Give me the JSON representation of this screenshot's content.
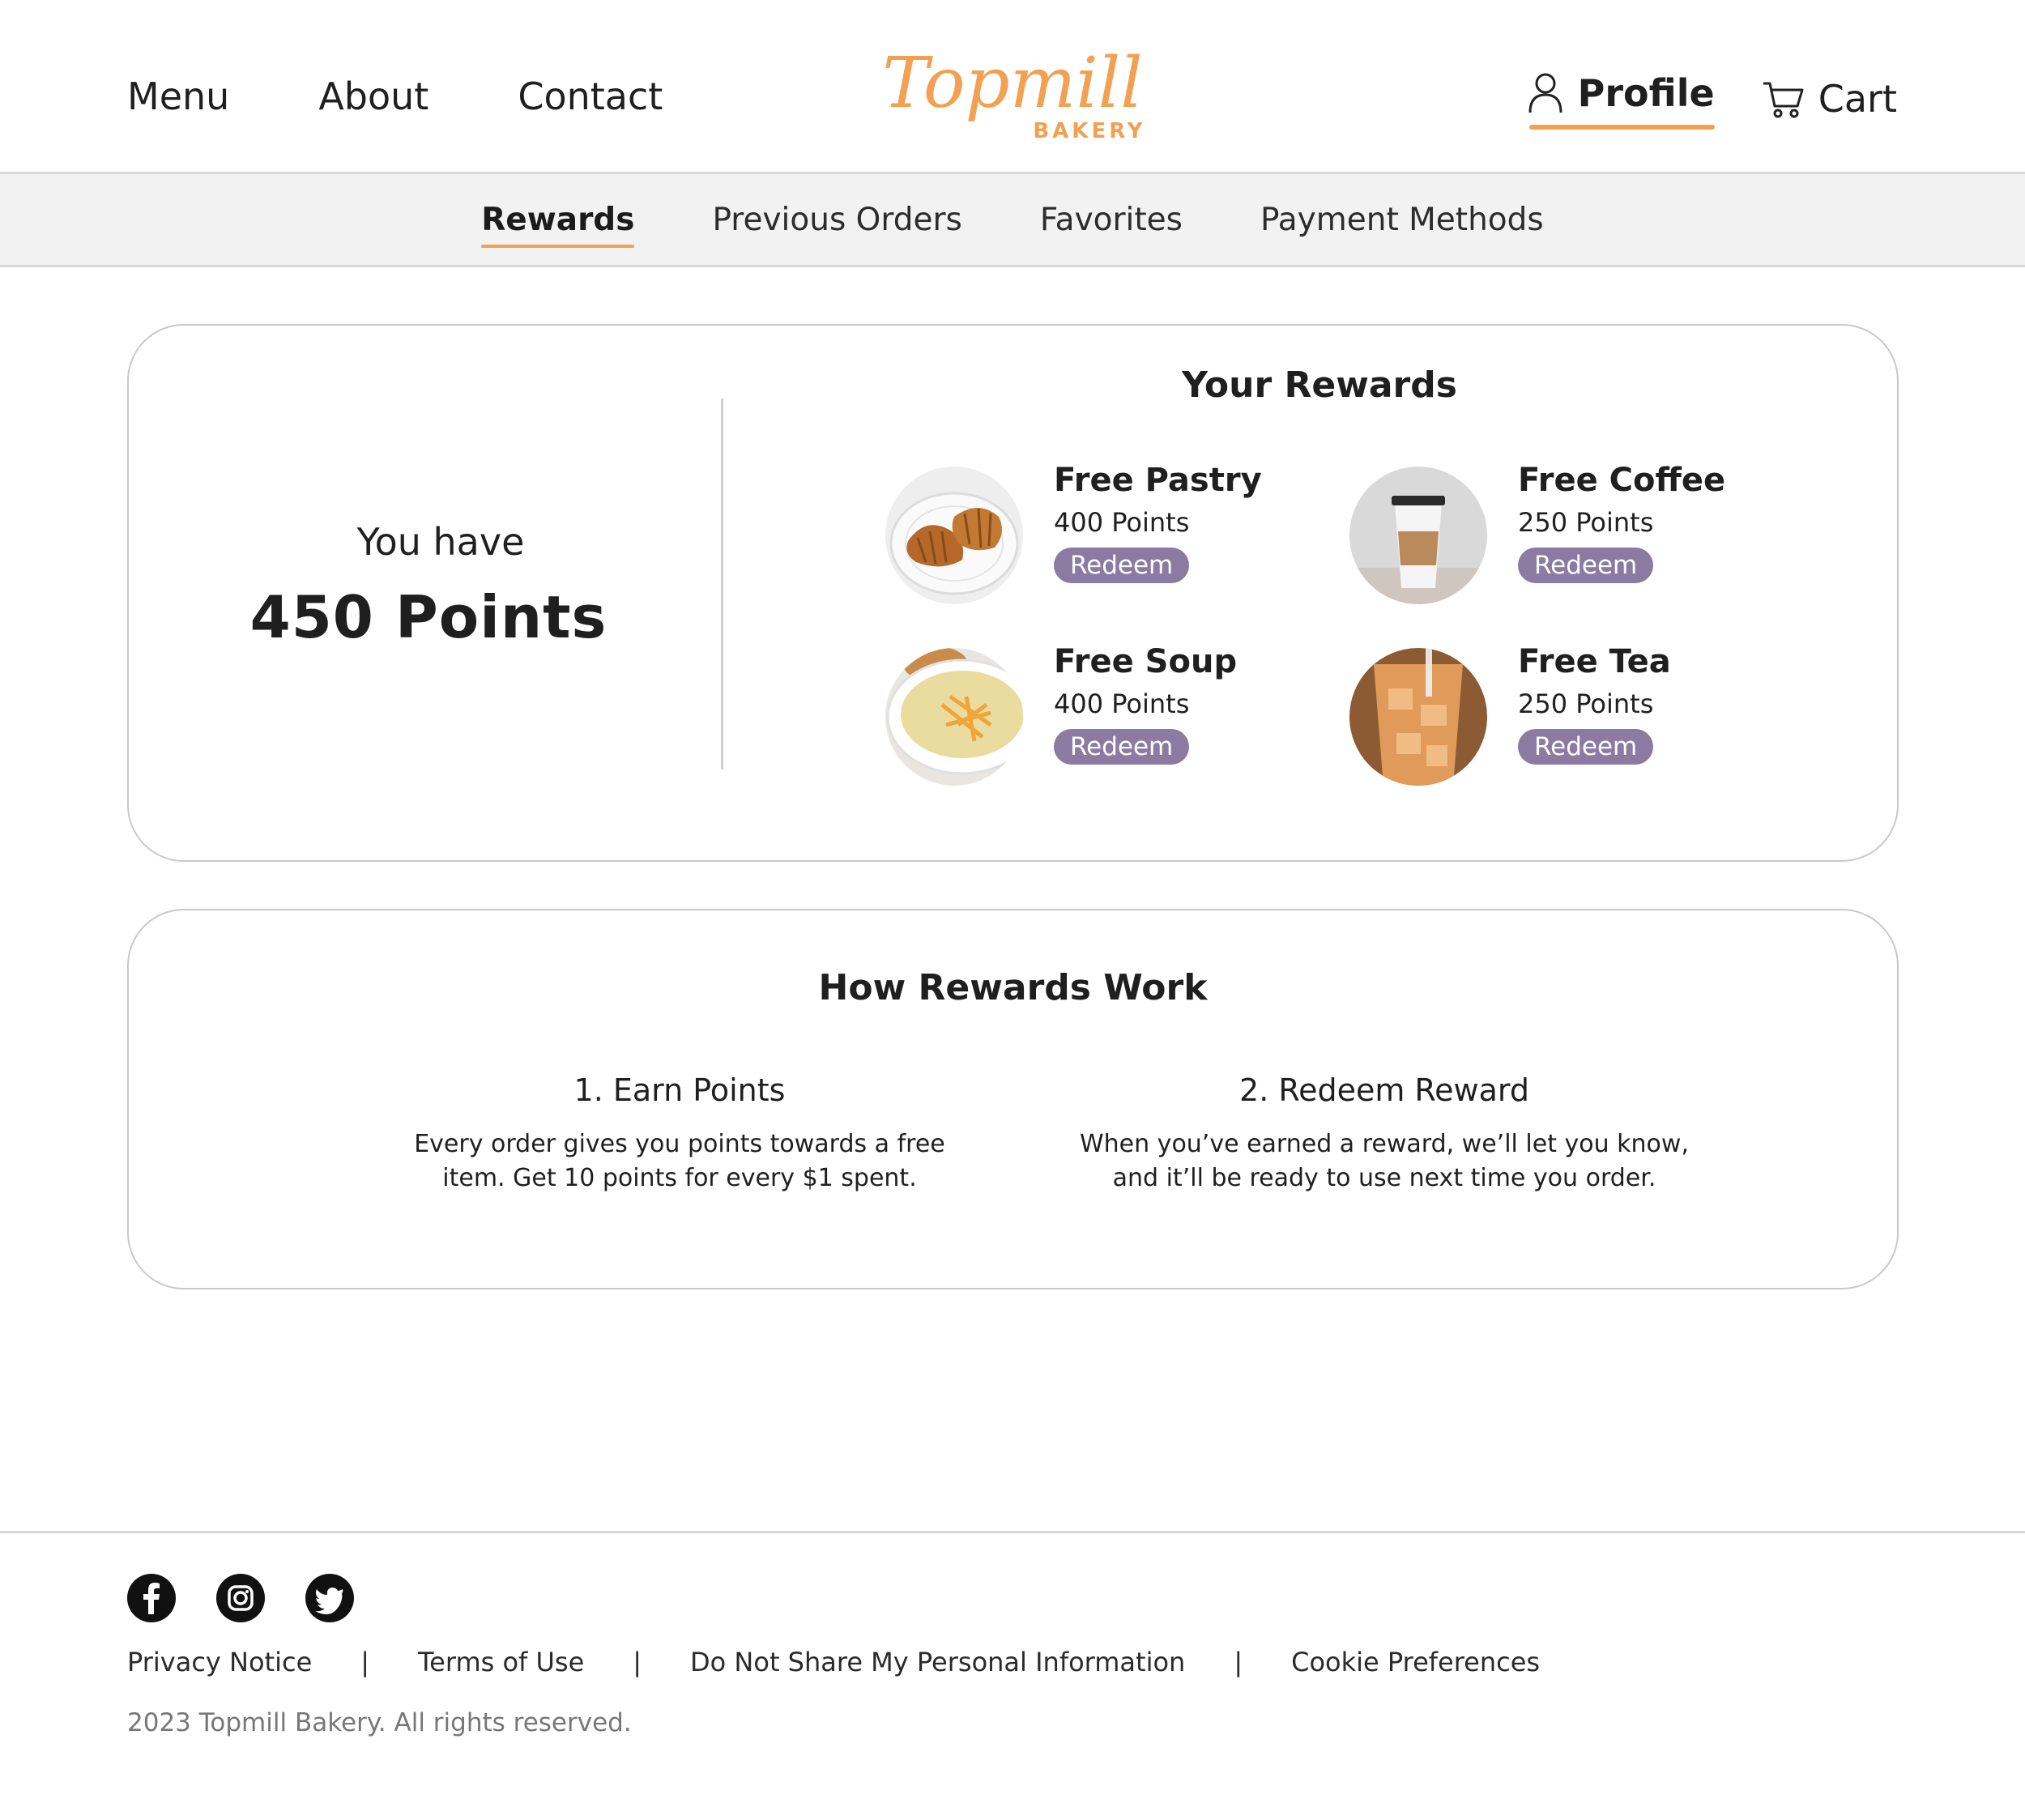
{
  "header": {
    "nav": [
      "Menu",
      "About",
      "Contact"
    ],
    "logo_script": "Topmill",
    "logo_sub": "BAKERY",
    "profile_label": "Profile",
    "cart_label": "Cart",
    "brand_color": "#f2a153"
  },
  "subnav": {
    "tabs": [
      "Rewards",
      "Previous Orders",
      "Favorites",
      "Payment Methods"
    ],
    "active": "Rewards"
  },
  "points": {
    "intro": "You have",
    "value": "450 Points"
  },
  "rewards": {
    "title": "Your Rewards",
    "button_color": "#8b7ba3",
    "items": [
      {
        "name": "Free Pastry",
        "points": "400 Points",
        "button": "Redeem",
        "image": "croissant"
      },
      {
        "name": "Free Coffee",
        "points": "250 Points",
        "button": "Redeem",
        "image": "coffee-cup"
      },
      {
        "name": "Free Soup",
        "points": "400 Points",
        "button": "Redeem",
        "image": "soup-bowl"
      },
      {
        "name": "Free Tea",
        "points": "250 Points",
        "button": "Redeem",
        "image": "iced-tea"
      }
    ]
  },
  "how": {
    "title": "How Rewards Work",
    "steps": [
      {
        "title": "1. Earn Points",
        "line1": "Every order gives you points towards a free",
        "line2": "item. Get 10 points for every $1 spent."
      },
      {
        "title": "2. Redeem Reward",
        "line1": "When you’ve earned a reward, we’ll let you know,",
        "line2": "and it’ll be ready to use next time you order."
      }
    ]
  },
  "footer": {
    "socials": [
      "facebook-icon",
      "instagram-icon",
      "twitter-icon"
    ],
    "links": [
      "Privacy Notice",
      "Terms of Use",
      "Do Not Share My Personal Information",
      "Cookie Preferences"
    ],
    "separator": "|",
    "copyright": "2023 Topmill Bakery. All rights reserved."
  }
}
